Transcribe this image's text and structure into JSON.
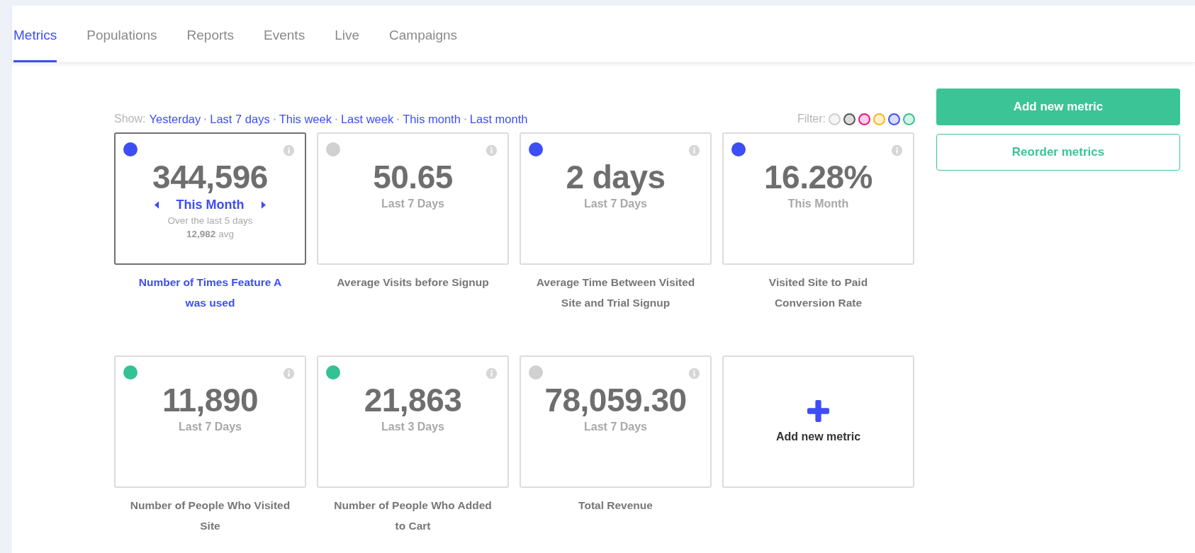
{
  "tabs": [
    {
      "label": "Metrics",
      "selected": true
    },
    {
      "label": "Populations",
      "selected": false
    },
    {
      "label": "Reports",
      "selected": false
    },
    {
      "label": "Events",
      "selected": false
    },
    {
      "label": "Live",
      "selected": false
    },
    {
      "label": "Campaigns",
      "selected": false
    }
  ],
  "show": {
    "label": "Show:",
    "options": [
      "Yesterday",
      "Last 7 days",
      "This week",
      "Last week",
      "This month",
      "Last month"
    ]
  },
  "filter": {
    "label": "Filter:",
    "colors": [
      {
        "color": "#cfcfcf"
      },
      {
        "color": "#555555"
      },
      {
        "color": "#e8157e"
      },
      {
        "color": "#f5b814"
      },
      {
        "color": "#3d4ef5"
      },
      {
        "color": "#33c293"
      }
    ]
  },
  "metrics": [
    {
      "kind": "metric",
      "selected": true,
      "color": "#3d4ef5",
      "value": "344,596",
      "period": "This Month",
      "detail": [
        "Over the last 5 days",
        "**12,982** avg"
      ],
      "label": "Number of Times Feature A was used"
    },
    {
      "kind": "metric",
      "selected": false,
      "color": "#d0d0d0",
      "value": "50.65",
      "period": "Last 7 Days",
      "label": "Average Visits before Signup"
    },
    {
      "kind": "metric",
      "selected": false,
      "color": "#3d4ef5",
      "value": "2 days",
      "period": "Last 7 Days",
      "label": "Average Time Between Visited Site and Trial Signup"
    },
    {
      "kind": "metric",
      "selected": false,
      "color": "#3d4ef5",
      "value": "16.28%",
      "period": "This Month",
      "label": "Visited Site to Paid Conversion Rate"
    },
    {
      "kind": "metric",
      "selected": false,
      "color": "#33c293",
      "value": "11,890",
      "period": "Last 7 Days",
      "label": "Number of People Who Visited Site"
    },
    {
      "kind": "metric",
      "selected": false,
      "color": "#33c293",
      "value": "21,863",
      "period": "Last 3 Days",
      "label": "Number of People Who Added to Cart"
    },
    {
      "kind": "metric",
      "selected": false,
      "color": "#d0d0d0",
      "value": "78,059.30",
      "period": "Last 7 Days",
      "label": "Total Revenue"
    },
    {
      "kind": "add",
      "label": "Add new metric"
    }
  ],
  "buttons": {
    "primary": "Add new metric",
    "secondary": "Reorder metrics"
  }
}
